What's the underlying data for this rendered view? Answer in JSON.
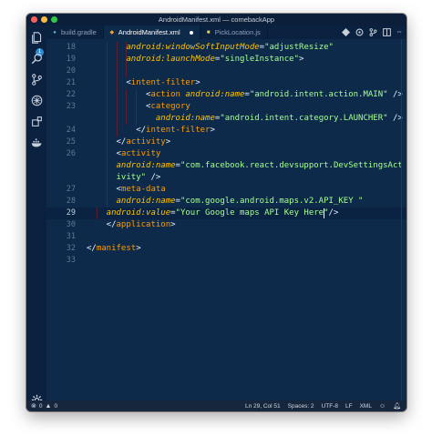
{
  "window": {
    "title": "AndroidManifest.xml — comebackApp"
  },
  "activity_bar": {
    "explorer_badge": "1"
  },
  "tabs": [
    {
      "label": "build.gradle",
      "icon": "gradle-file-icon",
      "active": false
    },
    {
      "label": "AndroidManifest.xml",
      "icon": "xml-file-icon",
      "active": true,
      "modified": true
    },
    {
      "label": "PickLocation.js",
      "icon": "js-file-icon",
      "active": false
    }
  ],
  "editor": {
    "current_line": "29",
    "lines": [
      {
        "n": "18",
        "tokens": [
          [
            "a",
            "android:windowSoftInputMode"
          ],
          [
            "p",
            "="
          ],
          [
            "v",
            "\"adjustResize\""
          ]
        ]
      },
      {
        "n": "19",
        "tokens": [
          [
            "a",
            "android:launchMode"
          ],
          [
            "p",
            "="
          ],
          [
            "v",
            "\"singleInstance\""
          ],
          [
            "p",
            ">"
          ]
        ]
      },
      {
        "n": "20",
        "tokens": []
      },
      {
        "n": "21",
        "tokens": [
          [
            "p",
            "<"
          ],
          [
            "t",
            "intent-filter"
          ],
          [
            "p",
            ">"
          ]
        ]
      },
      {
        "n": "22",
        "tokens": [
          [
            "p",
            "<"
          ],
          [
            "t",
            "action"
          ],
          [
            "p",
            " "
          ],
          [
            "a",
            "android:name"
          ],
          [
            "p",
            "="
          ],
          [
            "v",
            "\"android.intent.action.MAIN\""
          ],
          [
            "p",
            " />"
          ]
        ]
      },
      {
        "n": "23",
        "tokens": [
          [
            "p",
            "<"
          ],
          [
            "t",
            "category"
          ]
        ]
      },
      {
        "n": "",
        "tokens": [
          [
            "a",
            "android:name"
          ],
          [
            "p",
            "="
          ],
          [
            "v",
            "\"android.intent.category.LAUNCHER\""
          ],
          [
            "p",
            " />"
          ]
        ]
      },
      {
        "n": "24",
        "tokens": [
          [
            "p",
            "</"
          ],
          [
            "t",
            "intent-filter"
          ],
          [
            "p",
            ">"
          ]
        ]
      },
      {
        "n": "25",
        "tokens": [
          [
            "p",
            "</"
          ],
          [
            "t",
            "activity"
          ],
          [
            "p",
            ">"
          ]
        ]
      },
      {
        "n": "26",
        "tokens": [
          [
            "p",
            "<"
          ],
          [
            "t",
            "activity"
          ]
        ]
      },
      {
        "n": "",
        "tokens": [
          [
            "a",
            "android:name"
          ],
          [
            "p",
            "="
          ],
          [
            "v",
            "\"com.facebook.react.devsupport.DevSettingsAct"
          ]
        ]
      },
      {
        "n": "",
        "tokens": [
          [
            "v",
            "ivity\""
          ],
          [
            "p",
            " />"
          ]
        ]
      },
      {
        "n": "27",
        "tokens": [
          [
            "p",
            "<"
          ],
          [
            "t",
            "meta-data"
          ]
        ]
      },
      {
        "n": "28",
        "tokens": [
          [
            "a",
            "android:name"
          ],
          [
            "p",
            "="
          ],
          [
            "v",
            "\"com.google.android.maps.v2.API_KEY \""
          ]
        ]
      },
      {
        "n": "29",
        "tokens": [
          [
            "a",
            "android:value"
          ],
          [
            "p",
            "="
          ],
          [
            "v",
            "\"Your Google maps API Key Here\""
          ],
          [
            "p",
            "/>"
          ]
        ]
      },
      {
        "n": "30",
        "tokens": [
          [
            "p",
            "</"
          ],
          [
            "t",
            "application"
          ],
          [
            "p",
            ">"
          ]
        ]
      },
      {
        "n": "31",
        "tokens": []
      },
      {
        "n": "32",
        "tokens": [
          [
            "p",
            "</"
          ],
          [
            "t",
            "manifest"
          ],
          [
            "p",
            ">"
          ]
        ]
      },
      {
        "n": "33",
        "tokens": []
      }
    ]
  },
  "status_bar": {
    "errors": "0",
    "warnings": "0",
    "position": "Ln 29, Col 51",
    "spaces": "Spaces: 2",
    "encoding": "UTF-8",
    "eol": "LF",
    "language": "XML"
  },
  "colors": {
    "editor_bg": "#0e2a4a",
    "tag": "#ff9d00",
    "attribute": "#ffc600",
    "string": "#a5ff90",
    "punctuation": "#e1efff",
    "indent_guide": "#6a1d2b"
  }
}
